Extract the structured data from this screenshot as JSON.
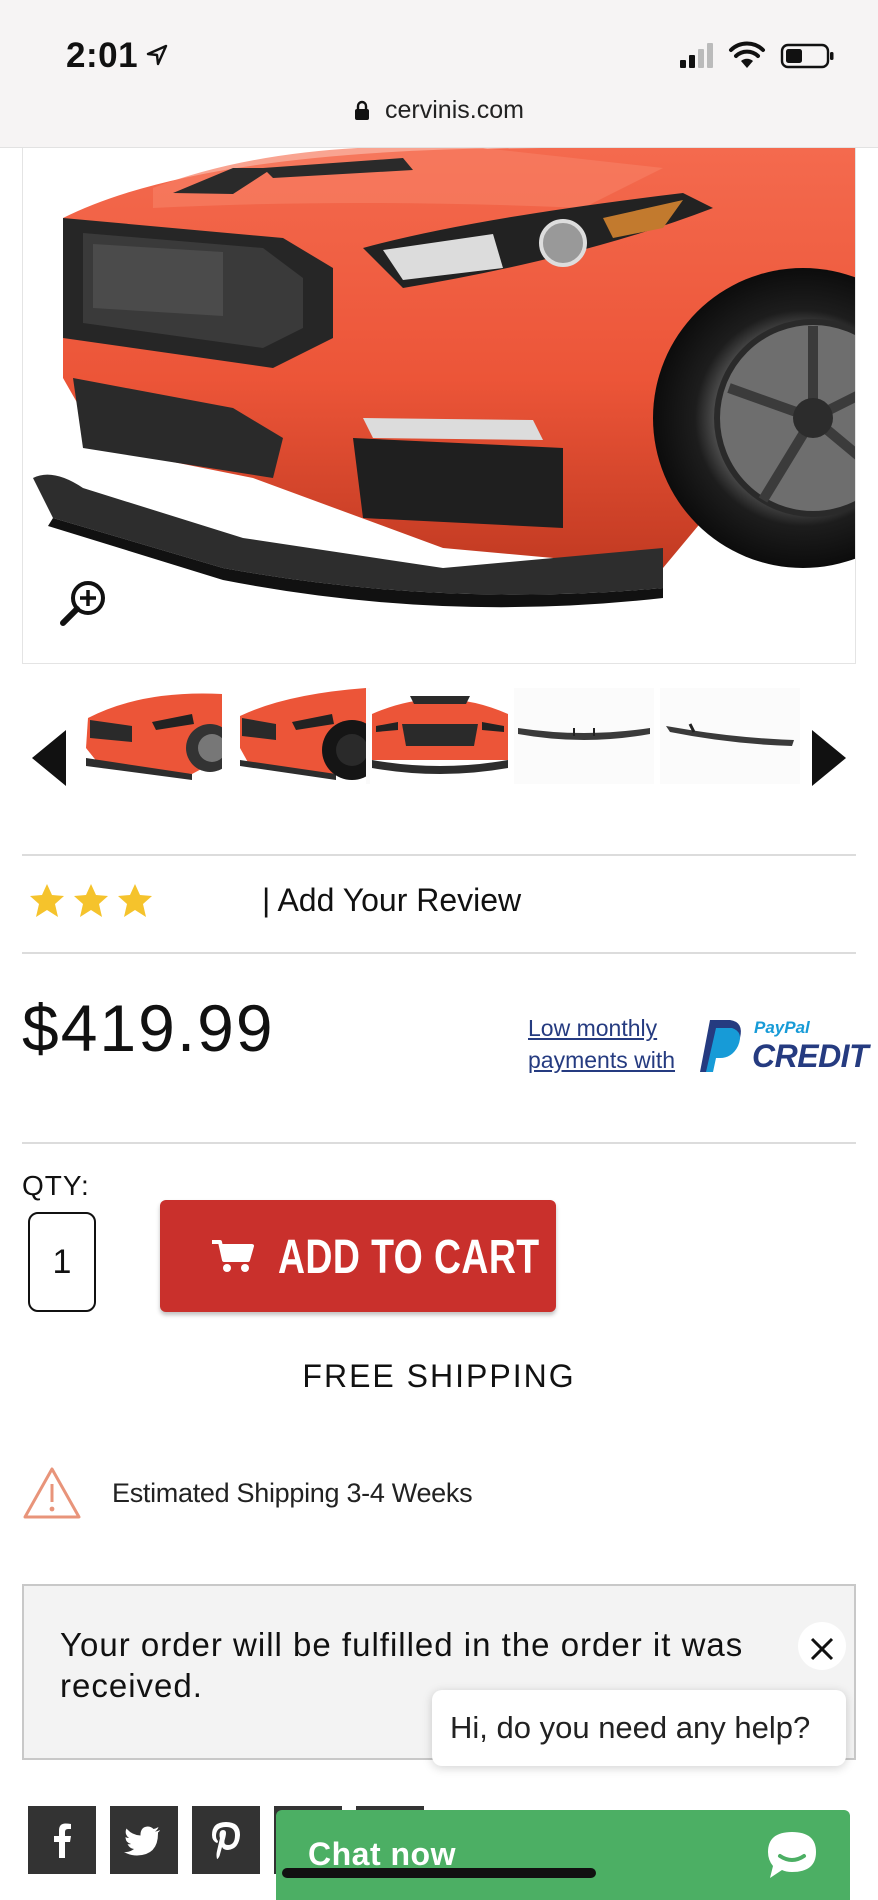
{
  "status_bar": {
    "time": "2:01",
    "url": "cervinis.com"
  },
  "product": {
    "rating_stars": 3,
    "review_link": "| Add Your Review",
    "price": "$419.99",
    "paypal": {
      "line1": "Low monthly",
      "line2": "payments with",
      "brand_small": "PayPal",
      "brand_large": "CREDIT"
    },
    "qty_label": "QTY:",
    "qty_value": "1",
    "add_to_cart": "ADD TO CART",
    "free_shipping": "FREE SHIPPING",
    "est_shipping": "Estimated Shipping 3-4 Weeks",
    "notice": "Your order will be fulfilled in the order it was received."
  },
  "thumbnails": [
    "front-quarter-view",
    "front-quarter-dark-wheel",
    "front-view",
    "lip-splitter-part",
    "lip-splitter-side"
  ],
  "chat": {
    "greeting": "Hi, do you need any help?",
    "button": "Chat now"
  },
  "social": [
    "facebook-icon",
    "twitter-icon",
    "pinterest-icon"
  ],
  "colors": {
    "cart_red": "#c9302c",
    "chat_green": "#4caf64",
    "star_gold": "#f5c32c",
    "paypal_navy": "#253b80",
    "paypal_blue": "#179bd7"
  }
}
